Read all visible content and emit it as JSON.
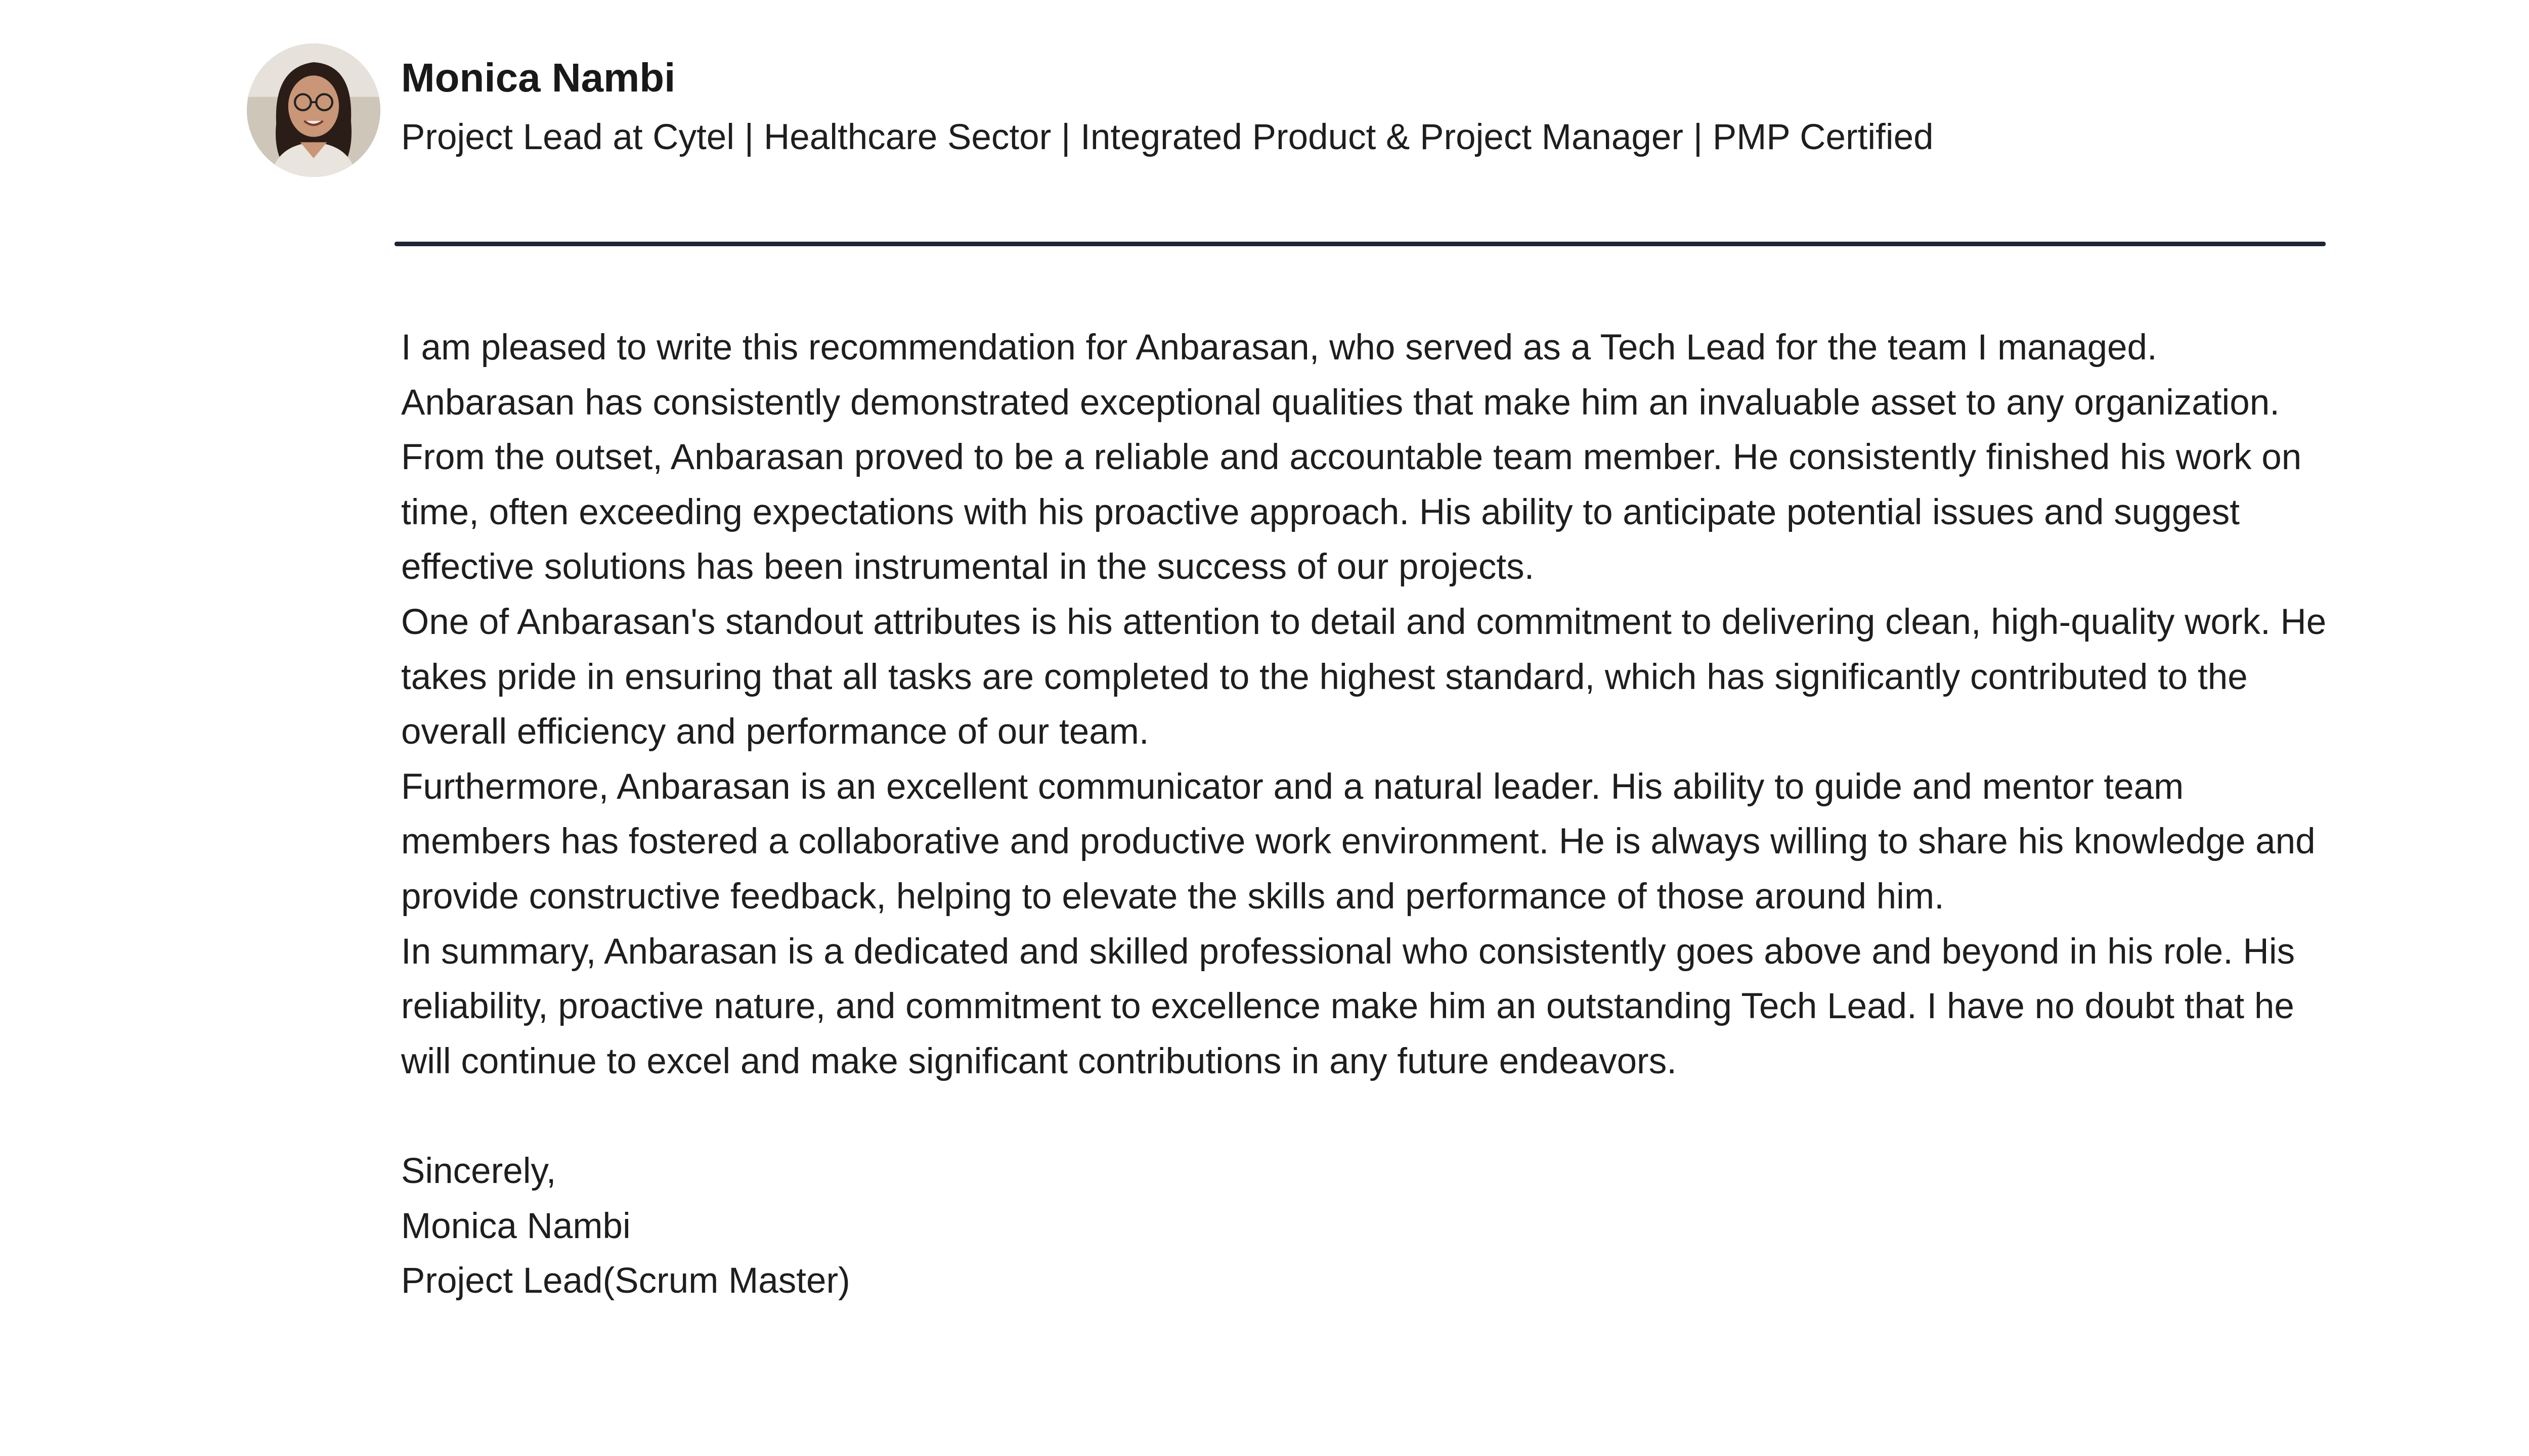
{
  "author": {
    "name": "Monica Nambi",
    "headline": "Project Lead at Cytel | Healthcare Sector | Integrated Product & Project Manager | PMP Certified",
    "avatar": "profile-photo"
  },
  "recommendation": {
    "paragraphs": [
      "I am pleased to write this recommendation for Anbarasan, who served as a Tech Lead for the team I managed. Anbarasan has consistently demonstrated exceptional qualities that make him an invaluable asset to any organization.",
      "From the outset, Anbarasan proved to be a reliable and accountable team member. He consistently finished his work on time, often exceeding expectations with his proactive approach. His ability to anticipate potential issues and suggest effective solutions has been instrumental in the success of our projects.",
      "One of Anbarasan's standout attributes is his attention to detail and commitment to delivering clean, high-quality work. He takes pride in ensuring that all tasks are completed to the highest standard, which has significantly contributed to the overall efficiency and performance of our team.",
      "Furthermore, Anbarasan is an excellent communicator and a natural leader. His ability to guide and mentor team members has fostered a collaborative and productive work environment. He is always willing to share his knowledge and provide constructive feedback, helping to elevate the skills and performance of those around him.",
      "In summary, Anbarasan is a dedicated and skilled professional who consistently goes above and beyond in his role. His reliability, proactive nature, and commitment to excellence make him an outstanding Tech Lead. I have no doubt that he will continue to excel and make significant contributions in any future endeavors."
    ],
    "closing": "Sincerely,",
    "signature_name": "Monica Nambi",
    "signature_title": "Project Lead(Scrum Master)"
  },
  "colors": {
    "divider": "#1d2433",
    "text": "#1e1e1e",
    "background": "#ffffff"
  }
}
